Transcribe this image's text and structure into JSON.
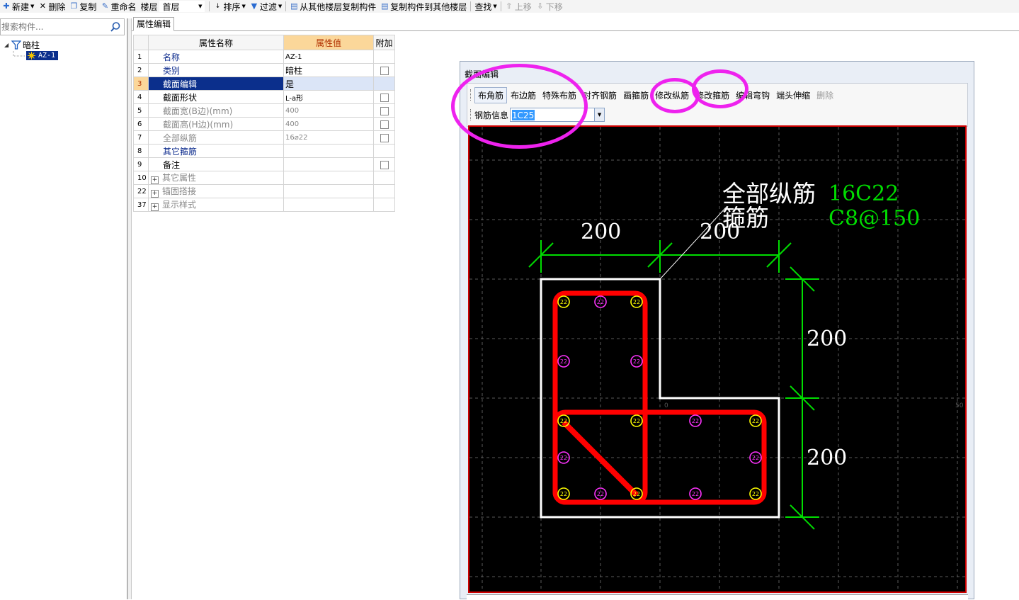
{
  "toolbar": {
    "new": "新建",
    "delete": "删除",
    "copy": "复制",
    "rename": "重命名",
    "floor_label": "楼层",
    "floor_value": "首层",
    "sort": "排序",
    "filter": "过滤",
    "copy_from_floor": "从其他楼层复制构件",
    "copy_to_floor": "复制构件到其他楼层",
    "find": "查找",
    "move_up": "上移",
    "move_down": "下移"
  },
  "left_panel": {
    "search_placeholder": "搜索构件...",
    "tree": {
      "root_label": "暗柱",
      "child_label": "AZ-1"
    }
  },
  "property_panel": {
    "tab": "属性编辑",
    "headers": {
      "name": "属性名称",
      "value": "属性值",
      "extra": "附加"
    },
    "rows": [
      {
        "idx": "1",
        "name": "名称",
        "value": "AZ-1"
      },
      {
        "idx": "2",
        "name": "类别",
        "value": "暗柱"
      },
      {
        "idx": "3",
        "name": "截面编辑",
        "value": "是"
      },
      {
        "idx": "4",
        "name": "截面形状",
        "value": "L-a形"
      },
      {
        "idx": "5",
        "name": "截面宽(B边)(mm)",
        "value": "400"
      },
      {
        "idx": "6",
        "name": "截面高(H边)(mm)",
        "value": "400"
      },
      {
        "idx": "7",
        "name": "全部纵筋",
        "value": "16⌀22"
      },
      {
        "idx": "8",
        "name": "其它箍筋",
        "value": ""
      },
      {
        "idx": "9",
        "name": "备注",
        "value": ""
      },
      {
        "idx": "10",
        "name": "其它属性",
        "value": ""
      },
      {
        "idx": "22",
        "name": "锚固搭接",
        "value": ""
      },
      {
        "idx": "37",
        "name": "显示样式",
        "value": ""
      }
    ]
  },
  "section_editor": {
    "title": "截面编辑",
    "toolbar": {
      "corner_rebar": "布角筋",
      "edge_rebar": "布边筋",
      "special_rebar": "特殊布筋",
      "align_rebar": "对齐钢筋",
      "draw_stirrup": "画箍筋",
      "modify_long": "修改纵筋",
      "modify_stirrup": "修改箍筋",
      "edit_hook": "编辑弯钩",
      "end_extend": "端头伸缩",
      "delete": "删除",
      "rebar_info_label": "钢筋信息",
      "rebar_info_value": "1C25"
    },
    "drawing": {
      "label_all_long": "全部纵筋",
      "label_stirrup": "箍筋",
      "value_all_long": "16C22",
      "value_stirrup": "C8@150",
      "dim_top_left": "200",
      "dim_top_right": "200",
      "dim_right_top": "200",
      "dim_right_bottom": "200",
      "bar_size": "22",
      "axis_zero": "0",
      "axis_right": "50"
    }
  },
  "colors": {
    "highlight_circle": "#ee22ee",
    "stirrup": "#ff0000",
    "dimension": "#00e000",
    "outline": "#ffffff",
    "corner_bar": "#ffff00",
    "edge_bar": "#ff33ff",
    "selected_row": "#0b2f8c"
  }
}
